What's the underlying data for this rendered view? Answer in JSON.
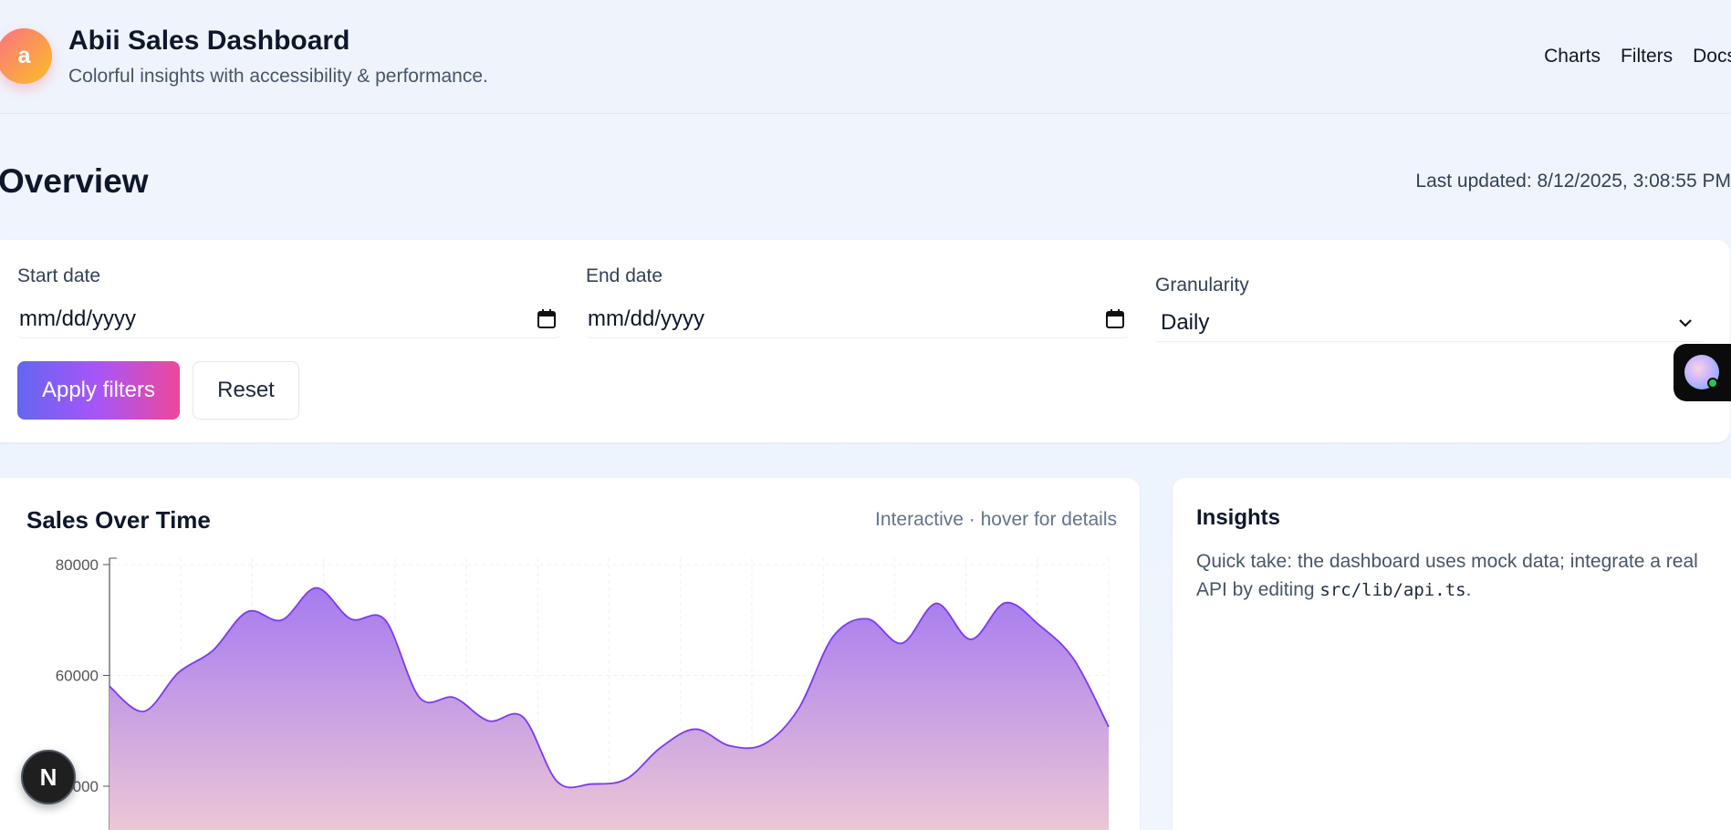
{
  "header": {
    "logo_letter": "a",
    "title": "Abii Sales Dashboard",
    "subtitle": "Colorful insights with accessibility & performance.",
    "nav": [
      "Charts",
      "Filters",
      "Docs"
    ]
  },
  "overview": {
    "title": "Overview",
    "last_updated": "Last updated: 8/12/2025, 3:08:55 PM"
  },
  "filters": {
    "start_label": "Start date",
    "start_value": "mm/dd/yyyy",
    "end_label": "End date",
    "end_value": "mm/dd/yyyy",
    "granularity_label": "Granularity",
    "granularity_value": "Daily",
    "apply_label": "Apply filters",
    "reset_label": "Reset"
  },
  "chart_card": {
    "title": "Sales Over Time",
    "hint": "Interactive · hover for details"
  },
  "insights": {
    "title": "Insights",
    "text_before": "Quick take: the dashboard uses mock data; integrate a real API by editing ",
    "code": "src/lib/api.ts",
    "text_after": "."
  },
  "badge": {
    "letter": "N"
  },
  "colors": {
    "accent_start": "#6366f1",
    "accent_end": "#ec4899",
    "line": "#7c3aed"
  },
  "chart_data": {
    "type": "area",
    "title": "Sales Over Time",
    "xlabel": "",
    "ylabel": "",
    "y_ticks": [
      80000,
      60000,
      40000
    ],
    "y_tick_labels": [
      "80000",
      "60000",
      "000"
    ],
    "ylim": [
      40000,
      80000
    ],
    "grid": true,
    "values": [
      58000,
      53500,
      60500,
      64500,
      71500,
      70000,
      75800,
      70200,
      70000,
      56000,
      56000,
      51800,
      52500,
      40800,
      40400,
      41300,
      47000,
      50300,
      47300,
      47600,
      54000,
      67000,
      70200,
      65800,
      73000,
      66500,
      73100,
      69000,
      62800,
      50700
    ]
  }
}
